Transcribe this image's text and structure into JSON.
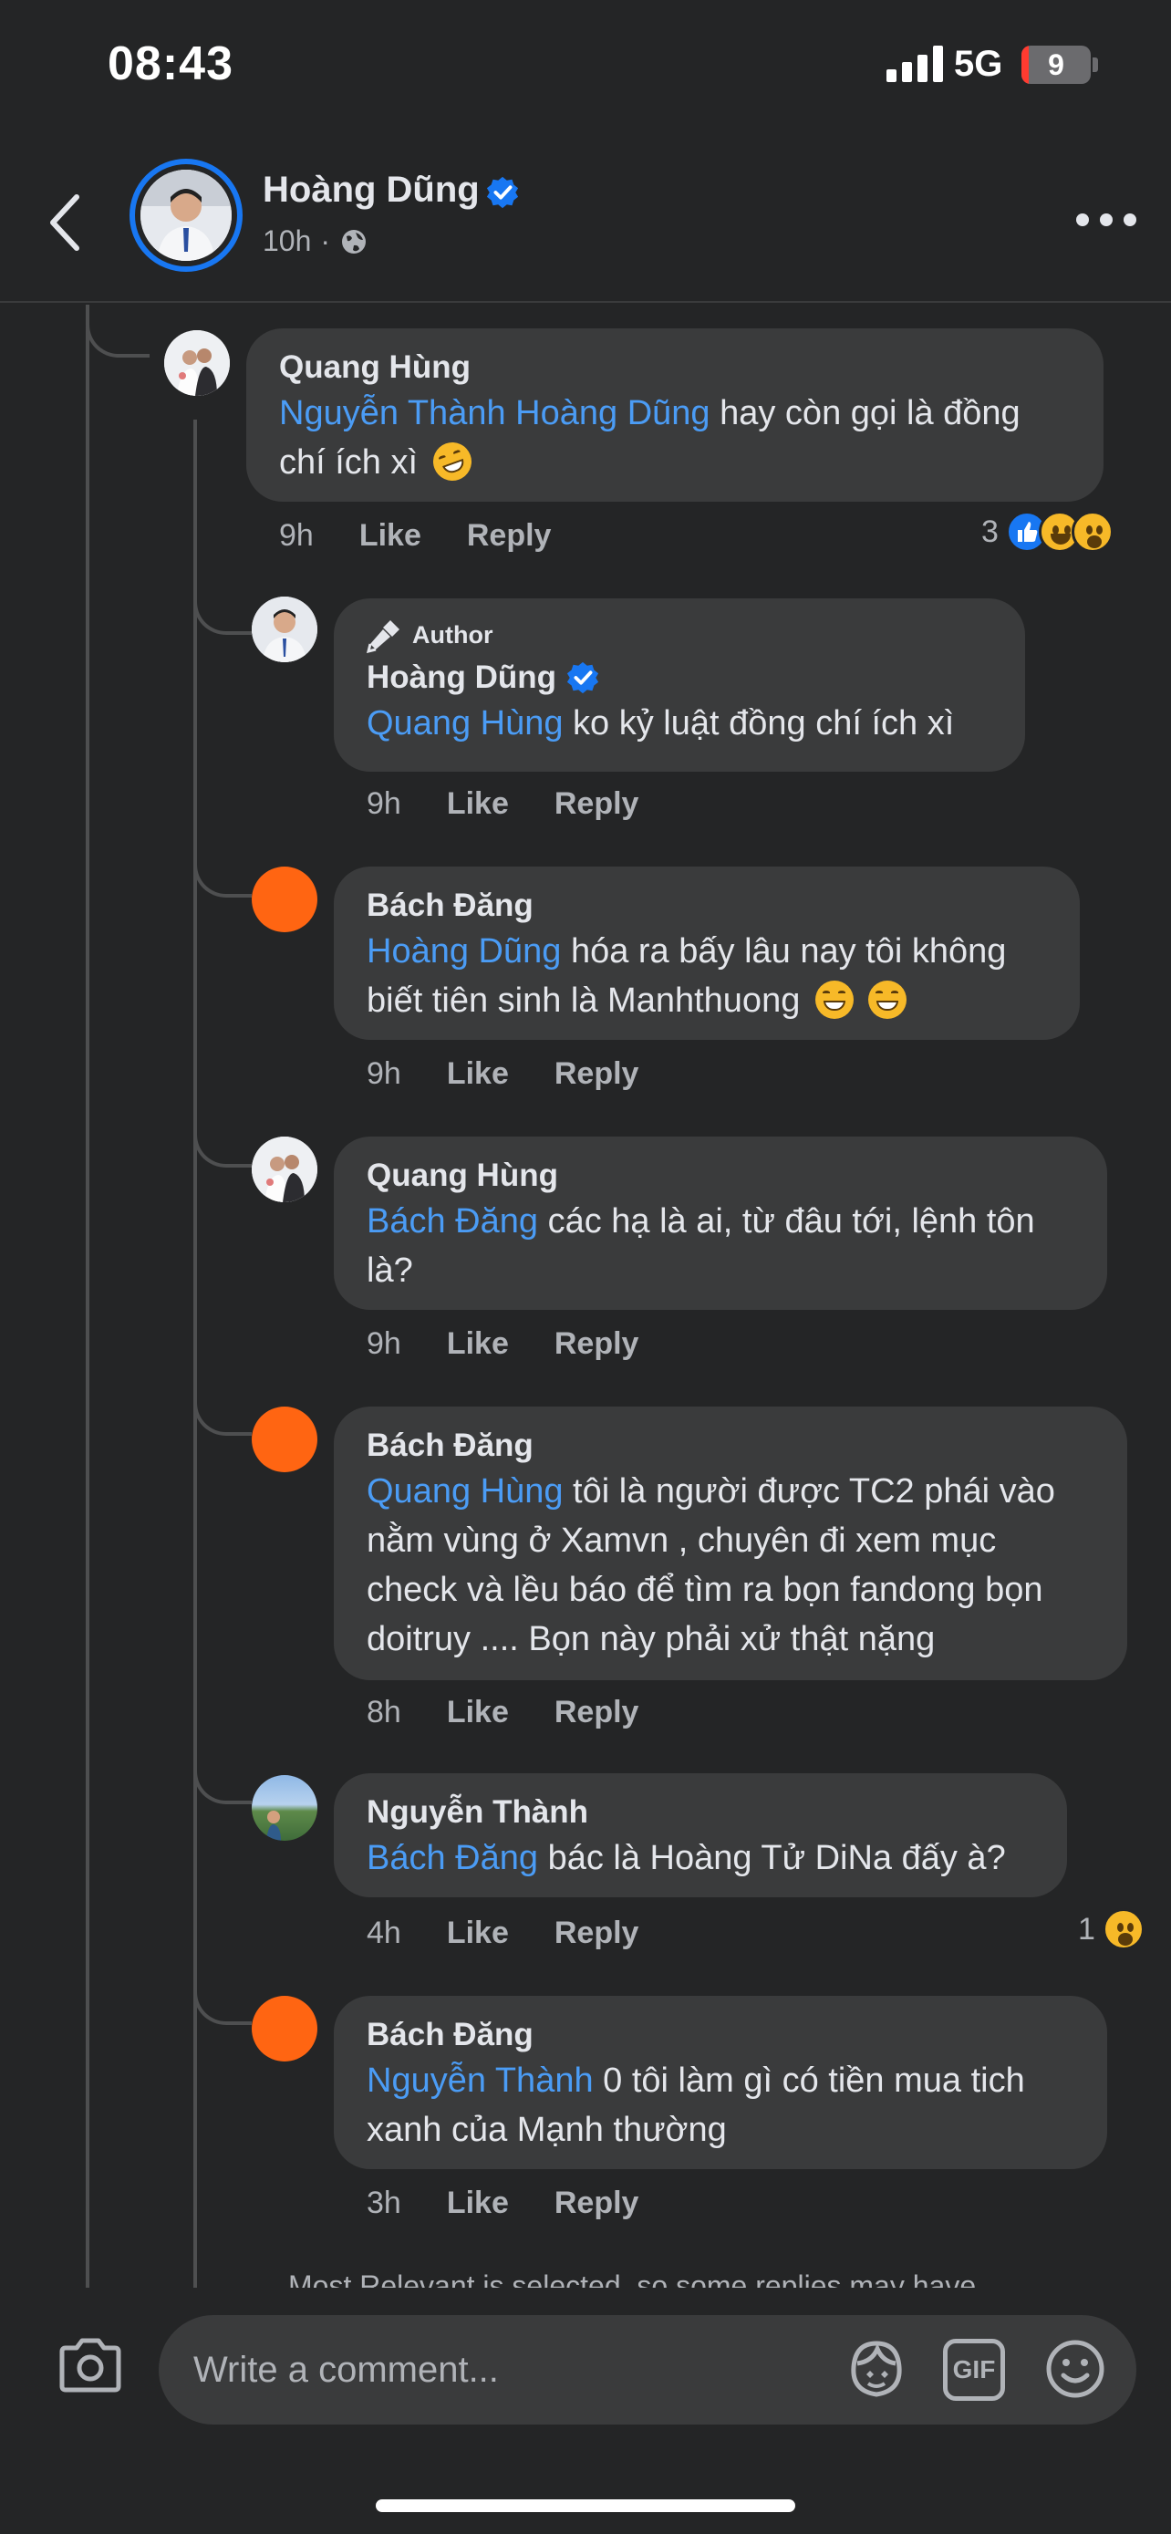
{
  "status_bar": {
    "time": "08:43",
    "network": "5G",
    "battery": "9"
  },
  "post_header": {
    "author": "Hoàng Dũng",
    "time": "10h",
    "audience_icon": "globe-icon"
  },
  "comments": [
    {
      "author": "Quang Hùng",
      "mention": "Nguyễn Thành Hoàng Dũng",
      "text_line1": " hay còn gọi là đồng",
      "text_line2": "chí ích xì",
      "time": "9h",
      "like": "Like",
      "reply": "Reply",
      "reaction_count": "3",
      "reactions": [
        "like",
        "haha",
        "wow"
      ]
    },
    {
      "badge": "Author",
      "author": "Hoàng Dũng",
      "mention": "Quang Hùng",
      "text_line1": " ko kỷ luật đồng chí ích xì",
      "time": "9h",
      "like": "Like",
      "reply": "Reply"
    },
    {
      "author": "Bách Đăng",
      "mention": "Hoàng Dũng",
      "text_line1": " hóa ra bấy lâu nay tôi không",
      "text_line2": "biết tiên sinh là Manhthuong",
      "time": "9h",
      "like": "Like",
      "reply": "Reply"
    },
    {
      "author": "Quang Hùng",
      "mention": "Bách Đăng",
      "text_line1": " các hạ là ai, từ đâu tới, lệnh tôn",
      "text_line2": "là?",
      "time": "9h",
      "like": "Like",
      "reply": "Reply"
    },
    {
      "author": "Bách Đăng",
      "mention": "Quang Hùng",
      "text_line1": " tôi là người được TC2 phái vào",
      "text_line2": "nằm vùng ở Xamvn , chuyên đi xem mục",
      "text_line3": "check và lều báo để tìm ra bọn fandong bọn",
      "text_line4": "doitruy  .... Bọn này phải xử thật nặng",
      "time": "8h",
      "like": "Like",
      "reply": "Reply"
    },
    {
      "author": "Nguyễn Thành",
      "mention": "Bách Đăng",
      "text_line1": " bác là Hoàng Tử DiNa đấy à?",
      "time": "4h",
      "like": "Like",
      "reply": "Reply",
      "reaction_count": "1",
      "reactions": [
        "wow"
      ]
    },
    {
      "author": "Bách Đăng",
      "mention": "Nguyễn Thành",
      "text_line1": " 0 tôi làm gì có tiền mua tich",
      "text_line2": "xanh của Mạnh thường",
      "time": "3h",
      "like": "Like",
      "reply": "Reply"
    }
  ],
  "notice": "Most Relevant is selected, so some replies may have",
  "composer": {
    "placeholder": "Write a comment...",
    "gif_label": "GIF"
  },
  "colors": {
    "background": "#242526",
    "bubble": "#3a3b3c",
    "mention": "#4b9cf5",
    "verified": "#1877f2",
    "orange_avatar": "#ff6512"
  }
}
